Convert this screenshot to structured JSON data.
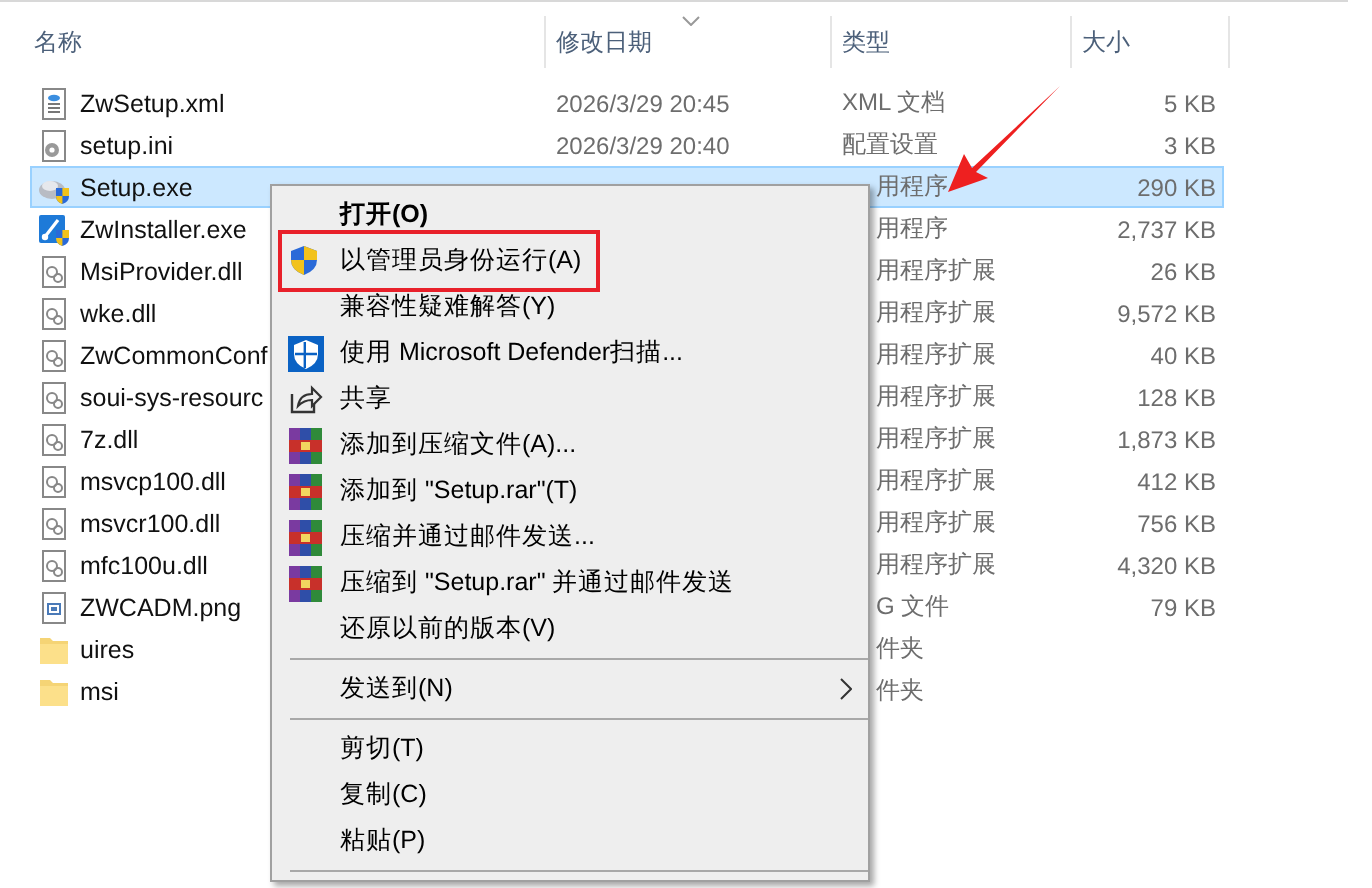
{
  "columns": [
    {
      "label": "名称"
    },
    {
      "label": "修改日期"
    },
    {
      "label": "类型"
    },
    {
      "label": "大小"
    }
  ],
  "files": [
    {
      "kind": "xml",
      "name": "ZwSetup.xml",
      "date": "2026/3/29 20:45",
      "type": "XML 文档",
      "size": "5 KB",
      "selected": false
    },
    {
      "kind": "ini",
      "name": "setup.ini",
      "date": "2026/3/29 20:40",
      "type": "配置设置",
      "size": "3 KB",
      "selected": false
    },
    {
      "kind": "exe",
      "name": "Setup.exe",
      "type": "用程序",
      "size": "290 KB",
      "selected": true
    },
    {
      "kind": "installer",
      "name": "ZwInstaller.exe",
      "type": "用程序",
      "size": "2,737 KB",
      "selected": false
    },
    {
      "kind": "dll",
      "name": "MsiProvider.dll",
      "type": "用程序扩展",
      "size": "26 KB",
      "selected": false
    },
    {
      "kind": "dll",
      "name": "wke.dll",
      "type": "用程序扩展",
      "size": "9,572 KB",
      "selected": false
    },
    {
      "kind": "dll",
      "name": "ZwCommonConf",
      "type": "用程序扩展",
      "size": "40 KB",
      "selected": false
    },
    {
      "kind": "dll",
      "name": "soui-sys-resourc",
      "type": "用程序扩展",
      "size": "128 KB",
      "selected": false
    },
    {
      "kind": "dll",
      "name": "7z.dll",
      "type": "用程序扩展",
      "size": "1,873 KB",
      "selected": false
    },
    {
      "kind": "dll",
      "name": "msvcp100.dll",
      "type": "用程序扩展",
      "size": "412 KB",
      "selected": false
    },
    {
      "kind": "dll",
      "name": "msvcr100.dll",
      "type": "用程序扩展",
      "size": "756 KB",
      "selected": false
    },
    {
      "kind": "dll",
      "name": "mfc100u.dll",
      "type": "用程序扩展",
      "size": "4,320 KB",
      "selected": false
    },
    {
      "kind": "image",
      "name": "ZWCADM.png",
      "type": "G 文件",
      "size": "79 KB",
      "selected": false
    },
    {
      "kind": "folder",
      "name": "uires",
      "type": "件夹",
      "selected": false
    },
    {
      "kind": "folder",
      "name": "msi",
      "type": "件夹",
      "selected": false
    }
  ],
  "context_menu": {
    "items": [
      {
        "kind": "item",
        "label": "打开(O)",
        "default": true
      },
      {
        "kind": "admin",
        "label": "以管理员身份运行(A)",
        "annotated": true
      },
      {
        "kind": "item",
        "label": "兼容性疑难解答(Y)"
      },
      {
        "kind": "scan",
        "label": "使用 Microsoft Defender扫描..."
      },
      {
        "kind": "share",
        "label": "共享"
      },
      {
        "kind": "archive",
        "label": "添加到压缩文件(A)..."
      },
      {
        "kind": "archive",
        "label": "添加到 \"Setup.rar\"(T)"
      },
      {
        "kind": "archive",
        "label": "压缩并通过邮件发送..."
      },
      {
        "kind": "archive",
        "label": "压缩到 \"Setup.rar\" 并通过邮件发送"
      },
      {
        "kind": "item",
        "label": "还原以前的版本(V)"
      },
      {
        "kind": "separator"
      },
      {
        "kind": "item",
        "label": "发送到(N)",
        "submenu": true
      },
      {
        "kind": "separator"
      },
      {
        "kind": "item",
        "label": "剪切(T)"
      },
      {
        "kind": "item",
        "label": "复制(C)"
      },
      {
        "kind": "item",
        "label": "粘贴(P)"
      },
      {
        "kind": "separator"
      }
    ]
  }
}
